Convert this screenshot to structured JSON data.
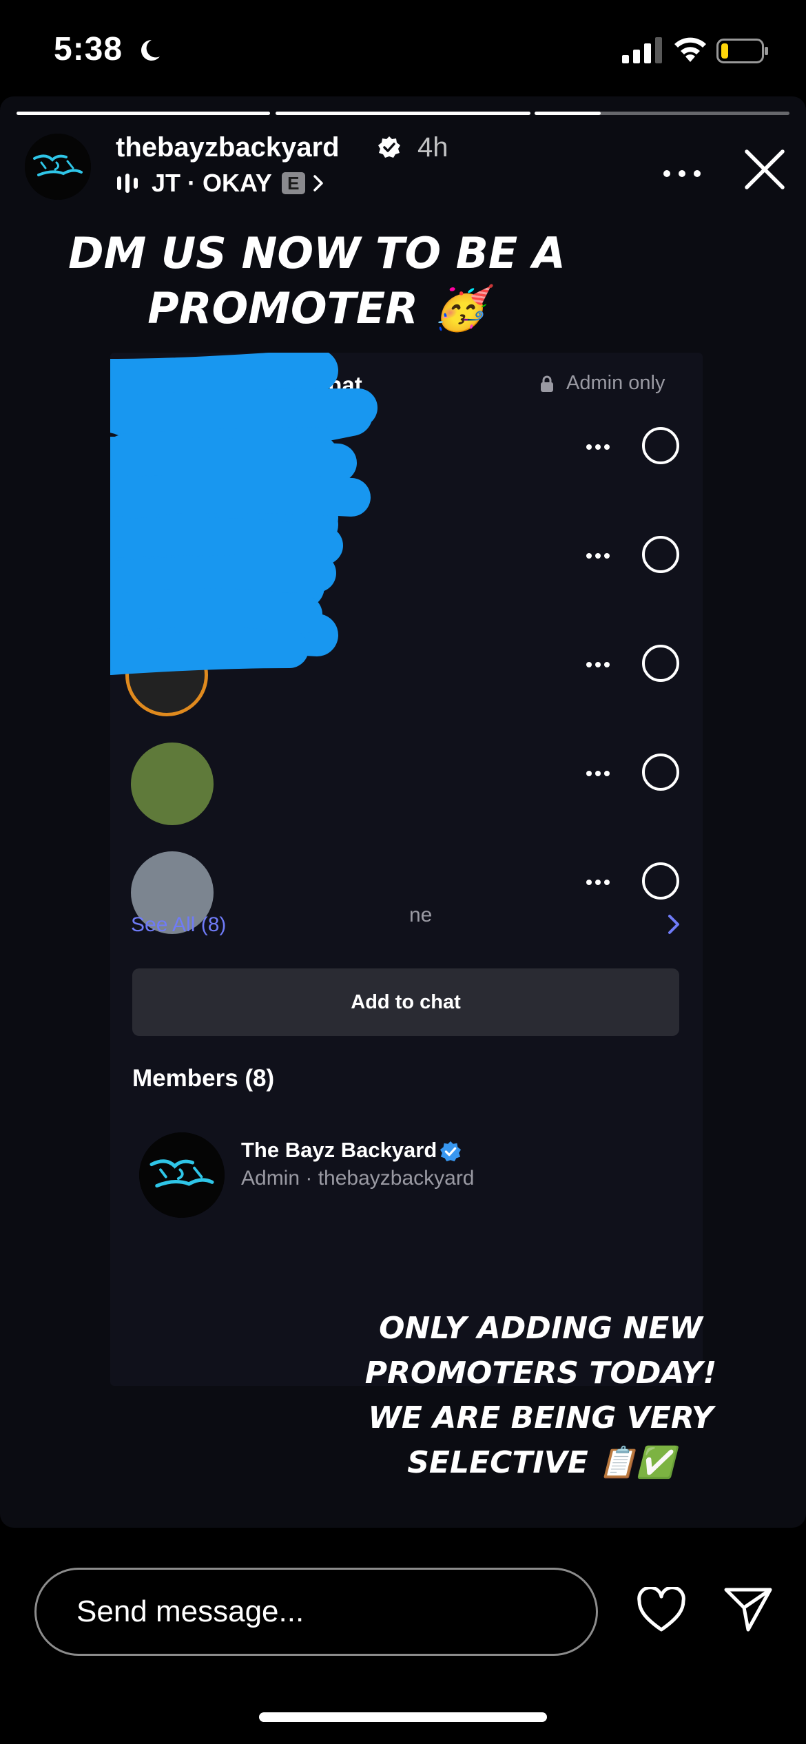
{
  "status_bar": {
    "time": "5:38",
    "icons": [
      "moon-icon",
      "cellular-signal-icon",
      "wifi-icon",
      "battery-icon"
    ],
    "battery_color": "#ffd60a"
  },
  "story": {
    "progress_segments": [
      {
        "progress": 1.0
      },
      {
        "progress": 1.0
      },
      {
        "progress": 0.26
      }
    ],
    "username": "thebayzbackyard",
    "time_ago": "4h",
    "music": {
      "artist": "JT",
      "separator": "·",
      "title": "OKAY",
      "explicit_badge": "E"
    },
    "headline_top": "DM US NOW TO BE A PROMOTER 🥳",
    "headline_bottom": "ONLY ADDING NEW PROMOTERS TODAY! WE ARE BEING VERY SELECTIVE 📋✅",
    "logo_text": "The Bayz Backyard",
    "logo_color": "#2fc6e8"
  },
  "chat_panel": {
    "requests_title": "Requests to join chat",
    "admin_only_label": "Admin only",
    "requests_visible_count": 5,
    "request_row_suffix": "ne",
    "scribble_color": "#1897f0",
    "see_all_label": "See All (8)",
    "add_button_label": "Add to chat",
    "members_title": "Members (8)",
    "members": [
      {
        "name": "The Bayz Backyard",
        "subtitle": "Admin · thebayzbackyard"
      }
    ],
    "accent_color": "#6f7bf7"
  },
  "bottom_bar": {
    "message_placeholder": "Send message...",
    "icons": [
      "heart-icon",
      "send-icon"
    ]
  }
}
